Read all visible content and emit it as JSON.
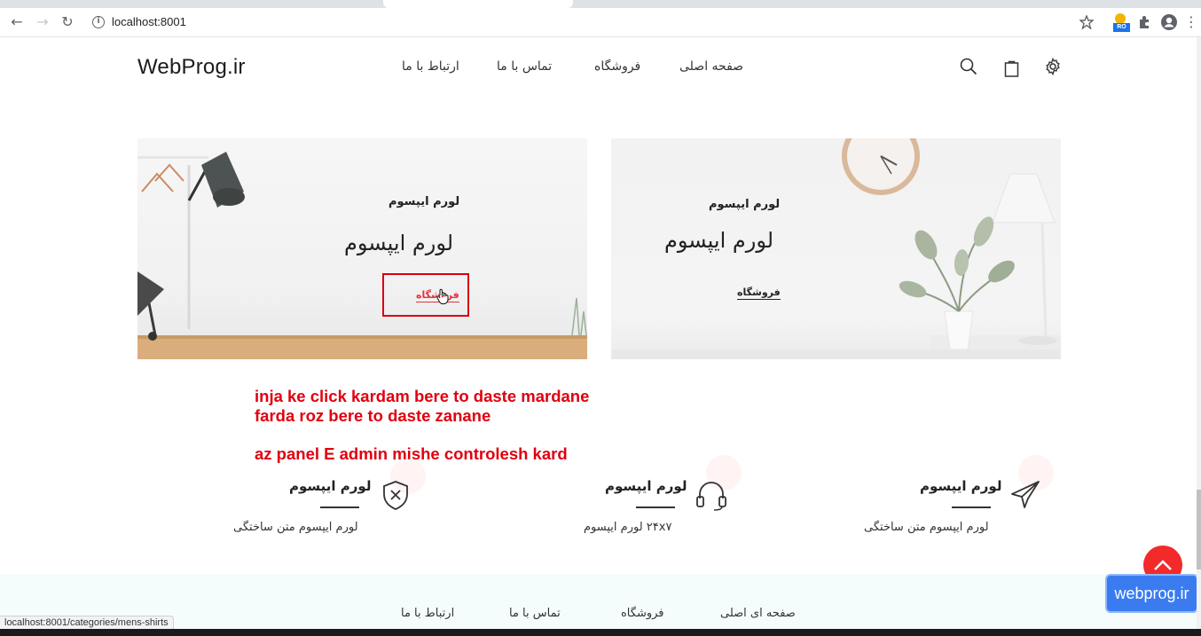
{
  "browser": {
    "url": "localhost:8001",
    "status_url": "localhost:8001/categories/mens-shirts",
    "extension_badge": "RO"
  },
  "header": {
    "logo": "WebProg.ir",
    "nav": [
      "صفحه اصلی",
      "فروشگاه",
      "تماس با ما",
      "ارتباط با ما"
    ]
  },
  "banners": [
    {
      "subtitle": "لورم ایپسوم",
      "title": "لورم ایپسوم",
      "link": "فروشگاه"
    },
    {
      "subtitle": "لورم ایپسوم",
      "title": "لورم ایپسوم",
      "link": "فروشگاه"
    }
  ],
  "annotation": {
    "line1": "inja ke click kardam bere to daste mardane",
    "line2": "farda roz bere to daste zanane",
    "line3": "az panel E admin mishe controlesh kard",
    "color": "#e0000f"
  },
  "features": [
    {
      "title": "لورم ایپسوم",
      "desc": "لورم ایپسوم متن ساختگی",
      "icon": "airplane-icon"
    },
    {
      "title": "لورم ایپسوم",
      "desc": "۲۴x۷ لورم ایپسوم",
      "icon": "headset-icon"
    },
    {
      "title": "لورم ایپسوم",
      "desc": "لورم ایپسوم متن ساختگی",
      "icon": "shield-x-icon"
    }
  ],
  "footer": {
    "nav": [
      "صفحه ای اصلی",
      "فروشگاه",
      "تماس با ما",
      "ارتباط با ما"
    ]
  },
  "badge": "webprog.ir",
  "colors": {
    "accent": "#f32a2a",
    "badge": "#3a7cf0",
    "link_active": "#e5323c"
  }
}
